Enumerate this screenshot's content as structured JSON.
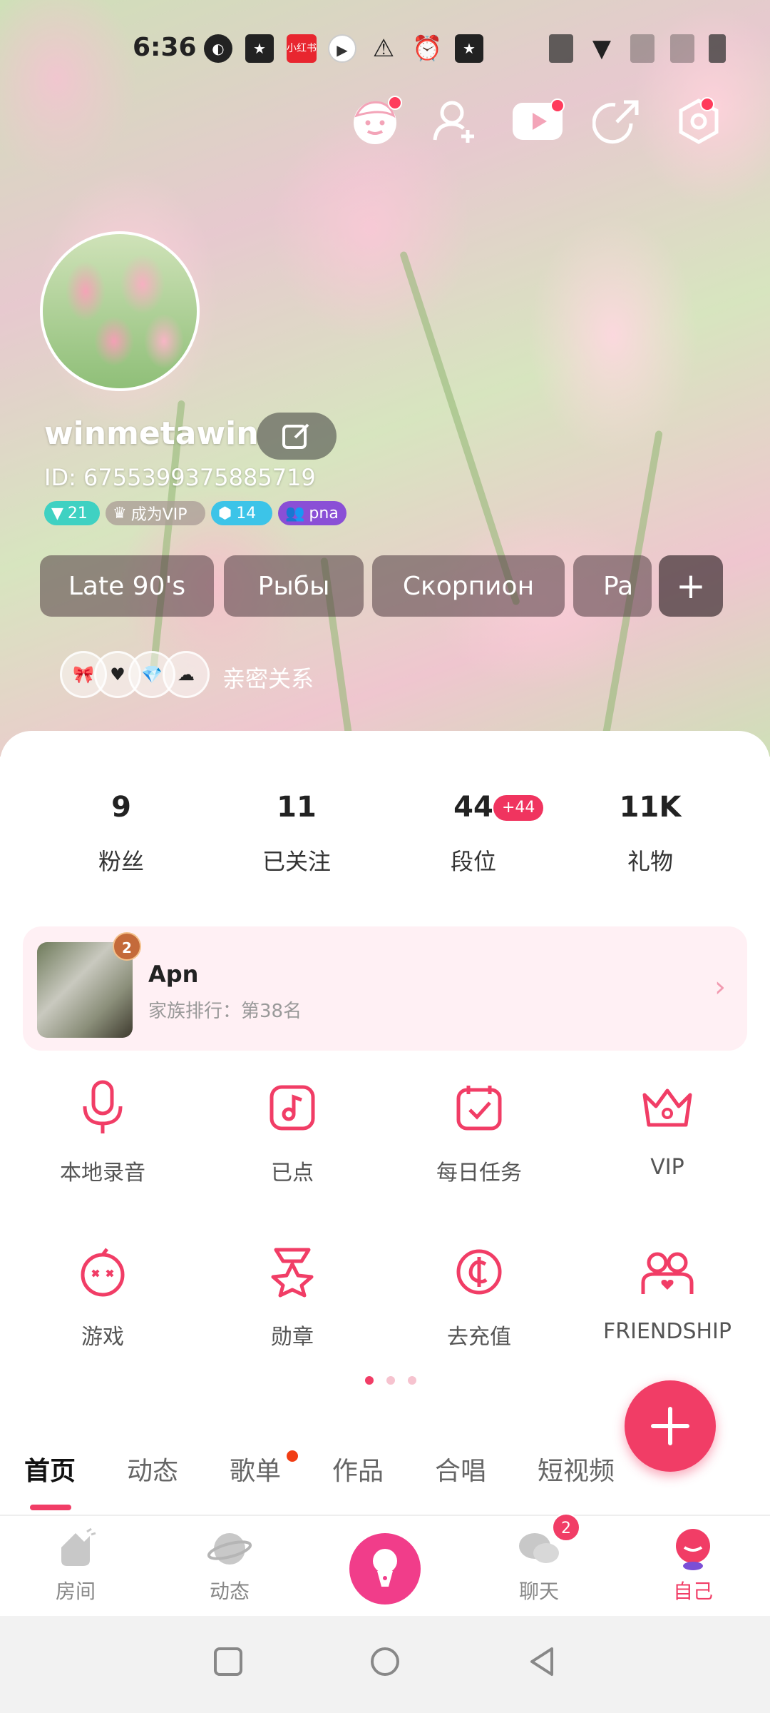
{
  "status_bar": {
    "time": "6:36",
    "app_icon_label": "小红书"
  },
  "profile": {
    "username": "winmetawin",
    "id_text": "ID: 6755399375885719",
    "badges": [
      {
        "text": "21",
        "color": "#3fd1c2"
      },
      {
        "text": "成为VIP",
        "color": "#b7a9a3"
      },
      {
        "text": "14",
        "color": "#3cc4e8"
      },
      {
        "text": "pna",
        "color": "#8a4fd6"
      }
    ],
    "tags": [
      "Late 90's",
      "Рыбы",
      "Скорпион",
      "Pa"
    ],
    "tag_add": "+",
    "intimate_label": "亲密关系"
  },
  "stats": [
    {
      "value": "9",
      "label": "粉丝"
    },
    {
      "value": "11",
      "label": "已关注"
    },
    {
      "value": "44",
      "label": "段位",
      "delta": "+44"
    },
    {
      "value": "11K",
      "label": "礼物"
    }
  ],
  "family": {
    "rank_badge": "2",
    "name": "Apn",
    "subtitle": "家族排行：第38名"
  },
  "features": [
    {
      "label": "本地录音",
      "icon": "mic-icon"
    },
    {
      "label": "已点",
      "icon": "music-note-icon"
    },
    {
      "label": "每日任务",
      "icon": "calendar-check-icon"
    },
    {
      "label": "VIP",
      "icon": "crown-icon"
    },
    {
      "label": "游戏",
      "icon": "game-icon"
    },
    {
      "label": "勋章",
      "icon": "medal-icon"
    },
    {
      "label": "去充值",
      "icon": "coin-icon"
    },
    {
      "label": "FRIENDSHIP",
      "icon": "friendship-icon"
    }
  ],
  "content_tabs": [
    "首页",
    "动态",
    "歌单",
    "作品",
    "合唱",
    "短视频"
  ],
  "bottom_nav": [
    {
      "label": "房间",
      "icon": "room-icon"
    },
    {
      "label": "动态",
      "icon": "planet-icon"
    },
    {
      "label": "",
      "icon": "mic-center-icon"
    },
    {
      "label": "聊天",
      "icon": "chat-icon",
      "badge": "2"
    },
    {
      "label": "自己",
      "icon": "me-icon"
    }
  ],
  "colors": {
    "accent": "#f13d66",
    "tab_dot": "#f13d14"
  }
}
